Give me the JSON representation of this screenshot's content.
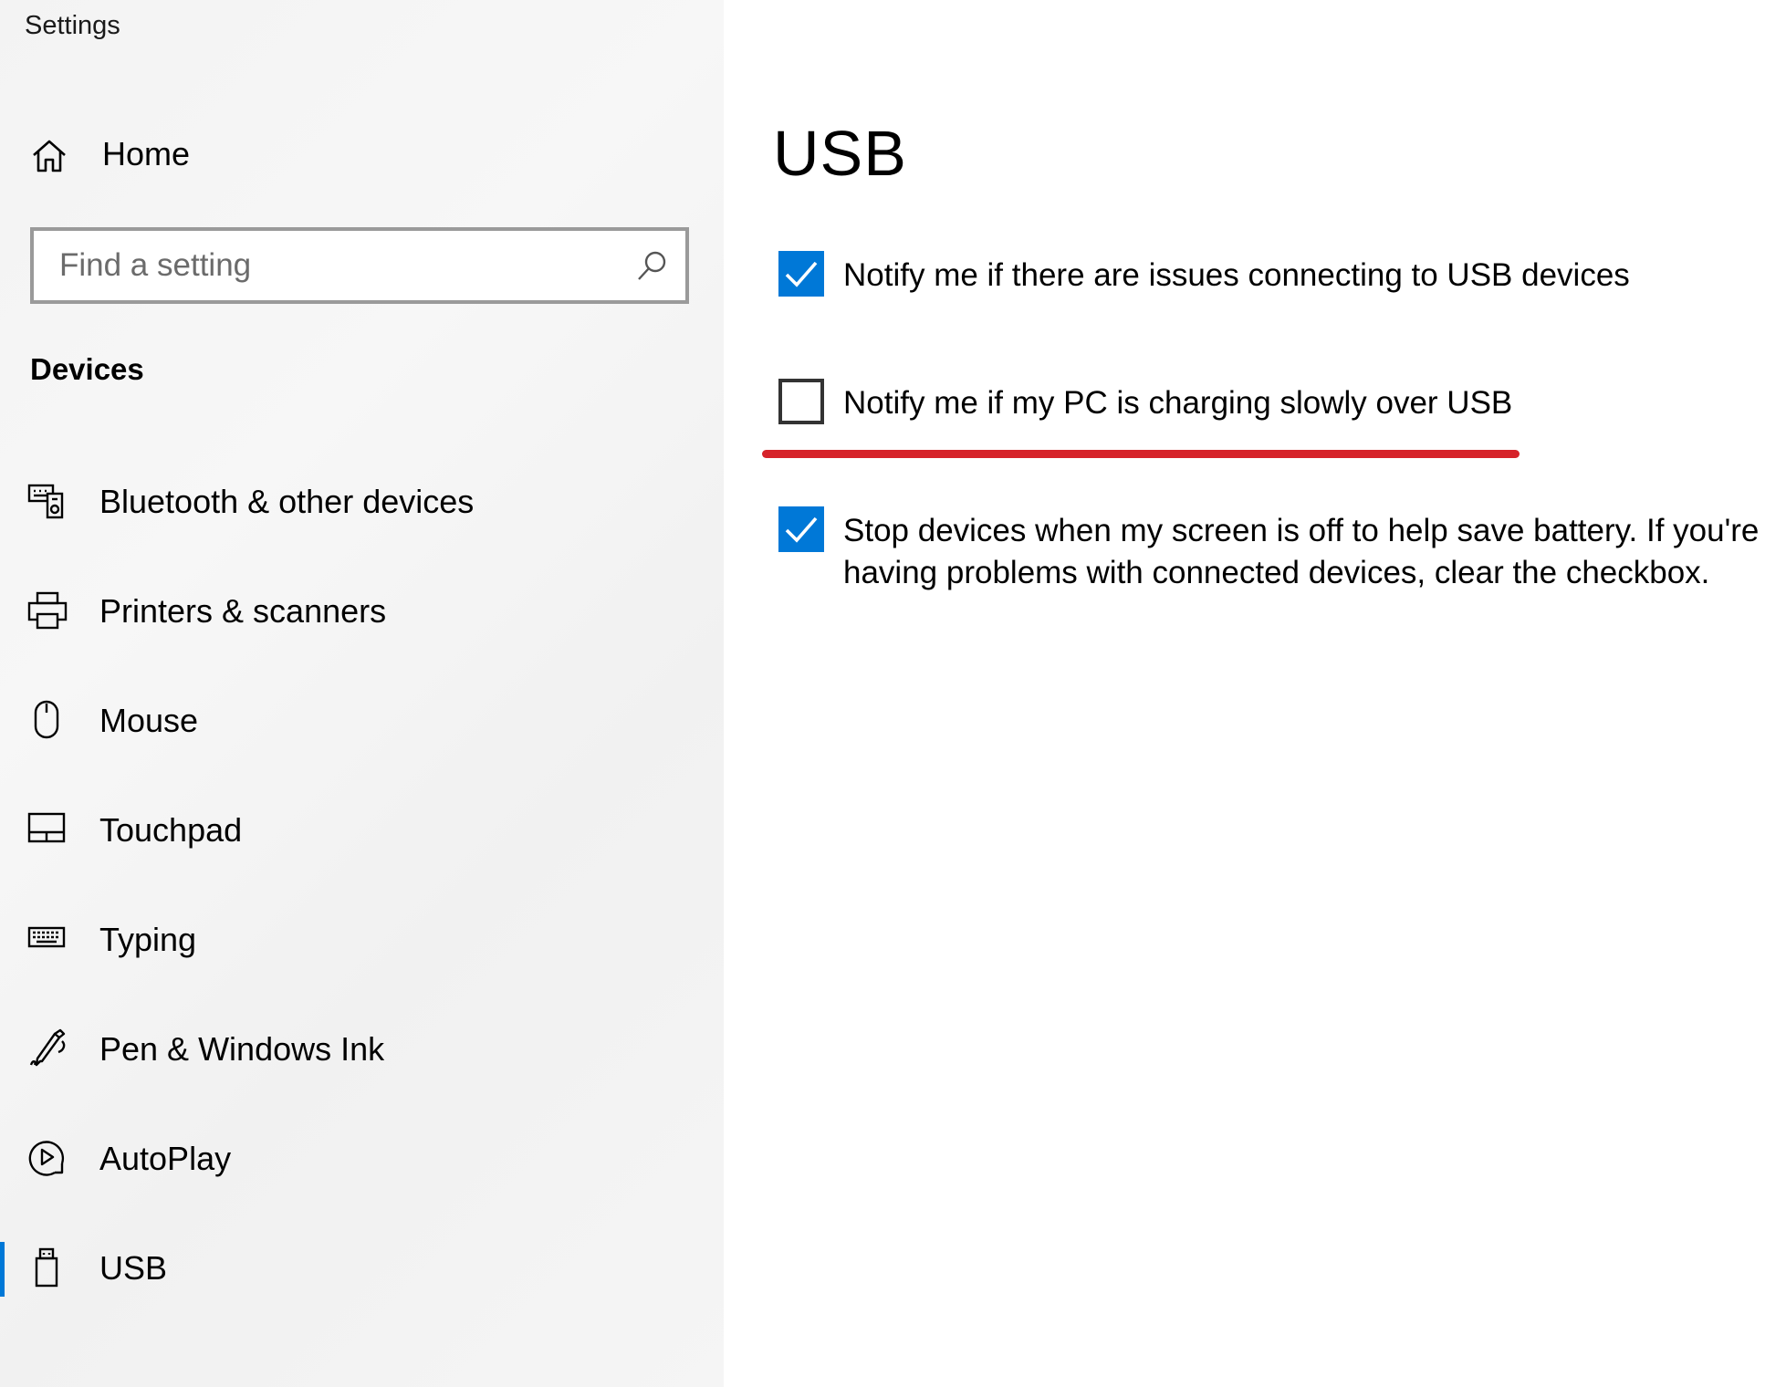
{
  "app": {
    "title": "Settings"
  },
  "sidebar": {
    "home_label": "Home",
    "search": {
      "placeholder": "Find a setting",
      "value": ""
    },
    "section_heading": "Devices",
    "items": [
      {
        "label": "Bluetooth & other devices",
        "icon": "bluetooth-devices-icon",
        "selected": false
      },
      {
        "label": "Printers & scanners",
        "icon": "printer-icon",
        "selected": false
      },
      {
        "label": "Mouse",
        "icon": "mouse-icon",
        "selected": false
      },
      {
        "label": "Touchpad",
        "icon": "touchpad-icon",
        "selected": false
      },
      {
        "label": "Typing",
        "icon": "keyboard-icon",
        "selected": false
      },
      {
        "label": "Pen & Windows Ink",
        "icon": "pen-icon",
        "selected": false
      },
      {
        "label": "AutoPlay",
        "icon": "autoplay-icon",
        "selected": false
      },
      {
        "label": "USB",
        "icon": "usb-icon",
        "selected": true
      }
    ]
  },
  "main": {
    "title": "USB",
    "options": [
      {
        "text": "Notify me if there are issues connecting to USB devices",
        "checked": true
      },
      {
        "text": "Notify me if my PC is charging slowly over USB",
        "checked": false
      },
      {
        "text": "Stop devices when my screen is off to help save battery. If you're having problems with connected devices, clear the checkbox.",
        "checked": true
      }
    ]
  },
  "colors": {
    "accent": "#0078d7",
    "annotation": "#d6232a",
    "sidebar_bg": "#f3f3f3"
  }
}
